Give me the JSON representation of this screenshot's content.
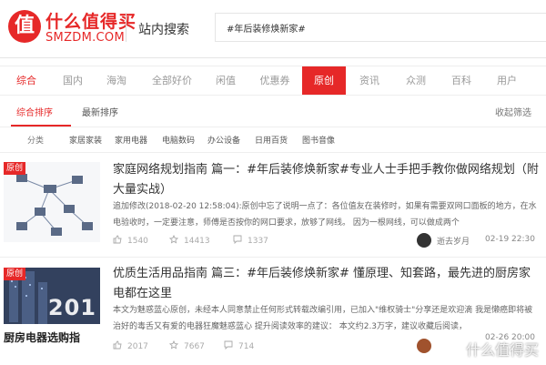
{
  "header": {
    "logo_mark": "值",
    "logo_cn": "什么值得买",
    "logo_en": "SMZDM.COM",
    "search_title": "站内搜索",
    "search_query": "#年后装修焕新家#"
  },
  "tabs": [
    "综合",
    "国内",
    "海淘",
    "全部好价",
    "闲值",
    "优惠券",
    "原创",
    "资讯",
    "众测",
    "百科",
    "用户"
  ],
  "sort": {
    "options": [
      "综合排序",
      "最新排序"
    ],
    "filter_label": "收起筛选"
  },
  "categories": {
    "label": "分类",
    "items": [
      "家居家装",
      "家用电器",
      "电脑数码",
      "办公设备",
      "日用百货",
      "图书音像"
    ]
  },
  "items": [
    {
      "badge": "原创",
      "title": "家庭网络规划指南 篇一：#年后装修焕新家#专业人士手把手教你做网络规划（附大量实战）",
      "summary": "追加修改(2018-02-20 12:58:04):原创中忘了说明一点了：各位值友在装修时，如果有需要双网口面板的地方，在水电验收时，一定要注意，师傅是否按你的网口要求，放够了网线。 因为一根网线，可以做成两个",
      "views": "1540",
      "likes": "14413",
      "comments": "1337",
      "author": "逝去岁月",
      "time": "02-19 22:30"
    },
    {
      "badge": "原创",
      "title": "优质生活用品指南 篇三：#年后装修焕新家# 懂原理、知套路，最先进的厨房家电都在这里",
      "summary": "本文为魅惑蓝心原创，未经本人同意禁止任何形式转载改编引用，已加入\"维权骑士\"分享还是欢迎滴 我是懒癌即将被治好的毒舌又有爱的电器狂魔魅惑蓝心 提升阅读效率的建议： 本文约2.3万字，建议收藏后阅读，",
      "views": "2017",
      "likes": "7667",
      "comments": "714",
      "time": "02-26 20:00",
      "thumb_text": "厨房电器选购指",
      "thumb_year": "201"
    }
  ],
  "watermark": "什么值得买",
  "colors": {
    "accent": "#e62828"
  }
}
